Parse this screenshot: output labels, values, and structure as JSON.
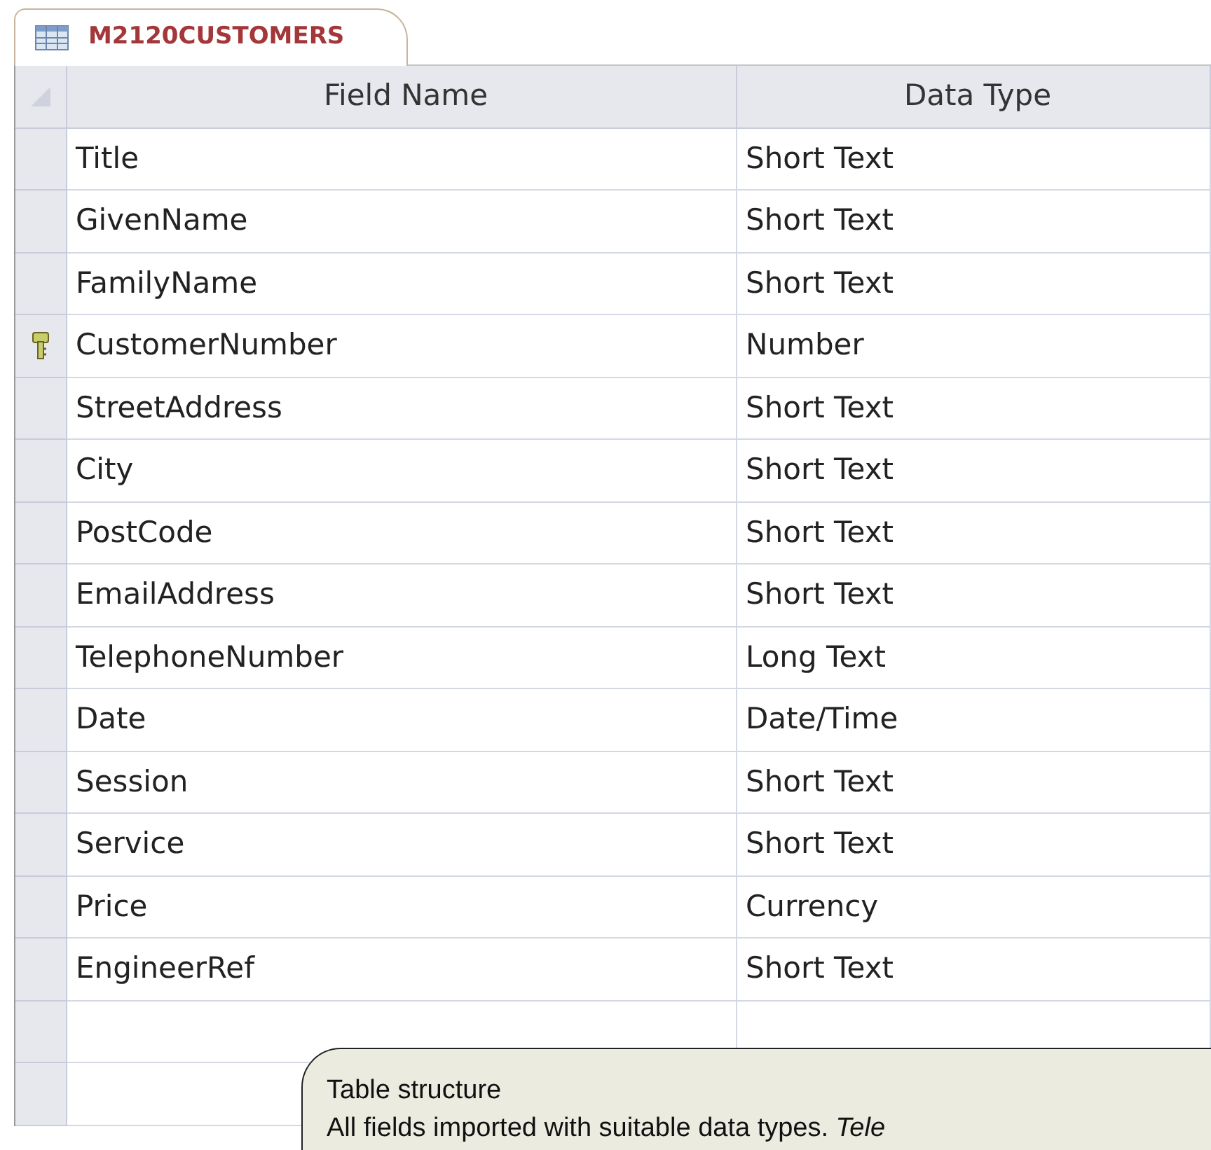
{
  "tab": {
    "title": "M2120CUSTOMERS",
    "selected": true
  },
  "table": {
    "columns": [
      "Field Name",
      "Data Type"
    ],
    "rows": [
      {
        "field_name": "Title",
        "data_type": "Short Text",
        "primary_key": false
      },
      {
        "field_name": "GivenName",
        "data_type": "Short Text",
        "primary_key": false
      },
      {
        "field_name": "FamilyName",
        "data_type": "Short Text",
        "primary_key": false
      },
      {
        "field_name": "CustomerNumber",
        "data_type": "Number",
        "primary_key": true
      },
      {
        "field_name": "StreetAddress",
        "data_type": "Short Text",
        "primary_key": false
      },
      {
        "field_name": "City",
        "data_type": "Short Text",
        "primary_key": false
      },
      {
        "field_name": "PostCode",
        "data_type": "Short Text",
        "primary_key": false
      },
      {
        "field_name": "EmailAddress",
        "data_type": "Short Text",
        "primary_key": false
      },
      {
        "field_name": "TelephoneNumber",
        "data_type": "Long Text",
        "primary_key": false
      },
      {
        "field_name": "Date",
        "data_type": "Date/Time",
        "primary_key": false
      },
      {
        "field_name": "Session",
        "data_type": "Short Text",
        "primary_key": false
      },
      {
        "field_name": "Service",
        "data_type": "Short Text",
        "primary_key": false
      },
      {
        "field_name": "Price",
        "data_type": "Currency",
        "primary_key": false
      },
      {
        "field_name": "EngineerRef",
        "data_type": "Short Text",
        "primary_key": false
      }
    ]
  },
  "callout": {
    "title": "Table structure",
    "text": "All fields imported with suitable data types. *Tele*"
  }
}
